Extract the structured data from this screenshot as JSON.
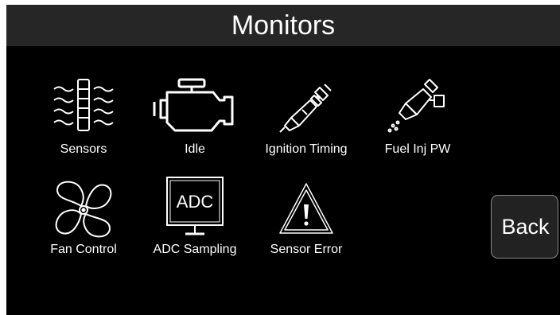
{
  "header": {
    "title": "Monitors"
  },
  "tiles": [
    {
      "label": "Sensors",
      "icon": "sensor-icon"
    },
    {
      "label": "Idle",
      "icon": "engine-icon"
    },
    {
      "label": "Ignition Timing",
      "icon": "spark-plug-icon"
    },
    {
      "label": "Fuel Inj PW",
      "icon": "fuel-injector-icon"
    },
    {
      "label": "Fan Control",
      "icon": "fan-icon"
    },
    {
      "label": "ADC Sampling",
      "icon": "adc-monitor-icon",
      "icon_text": "ADC"
    },
    {
      "label": "Sensor Error",
      "icon": "warning-icon"
    }
  ],
  "back_button": {
    "label": "Back"
  },
  "colors": {
    "background": "#000000",
    "header_background": "#262626",
    "text": "#ffffff",
    "icon_stroke": "#ffffff"
  }
}
